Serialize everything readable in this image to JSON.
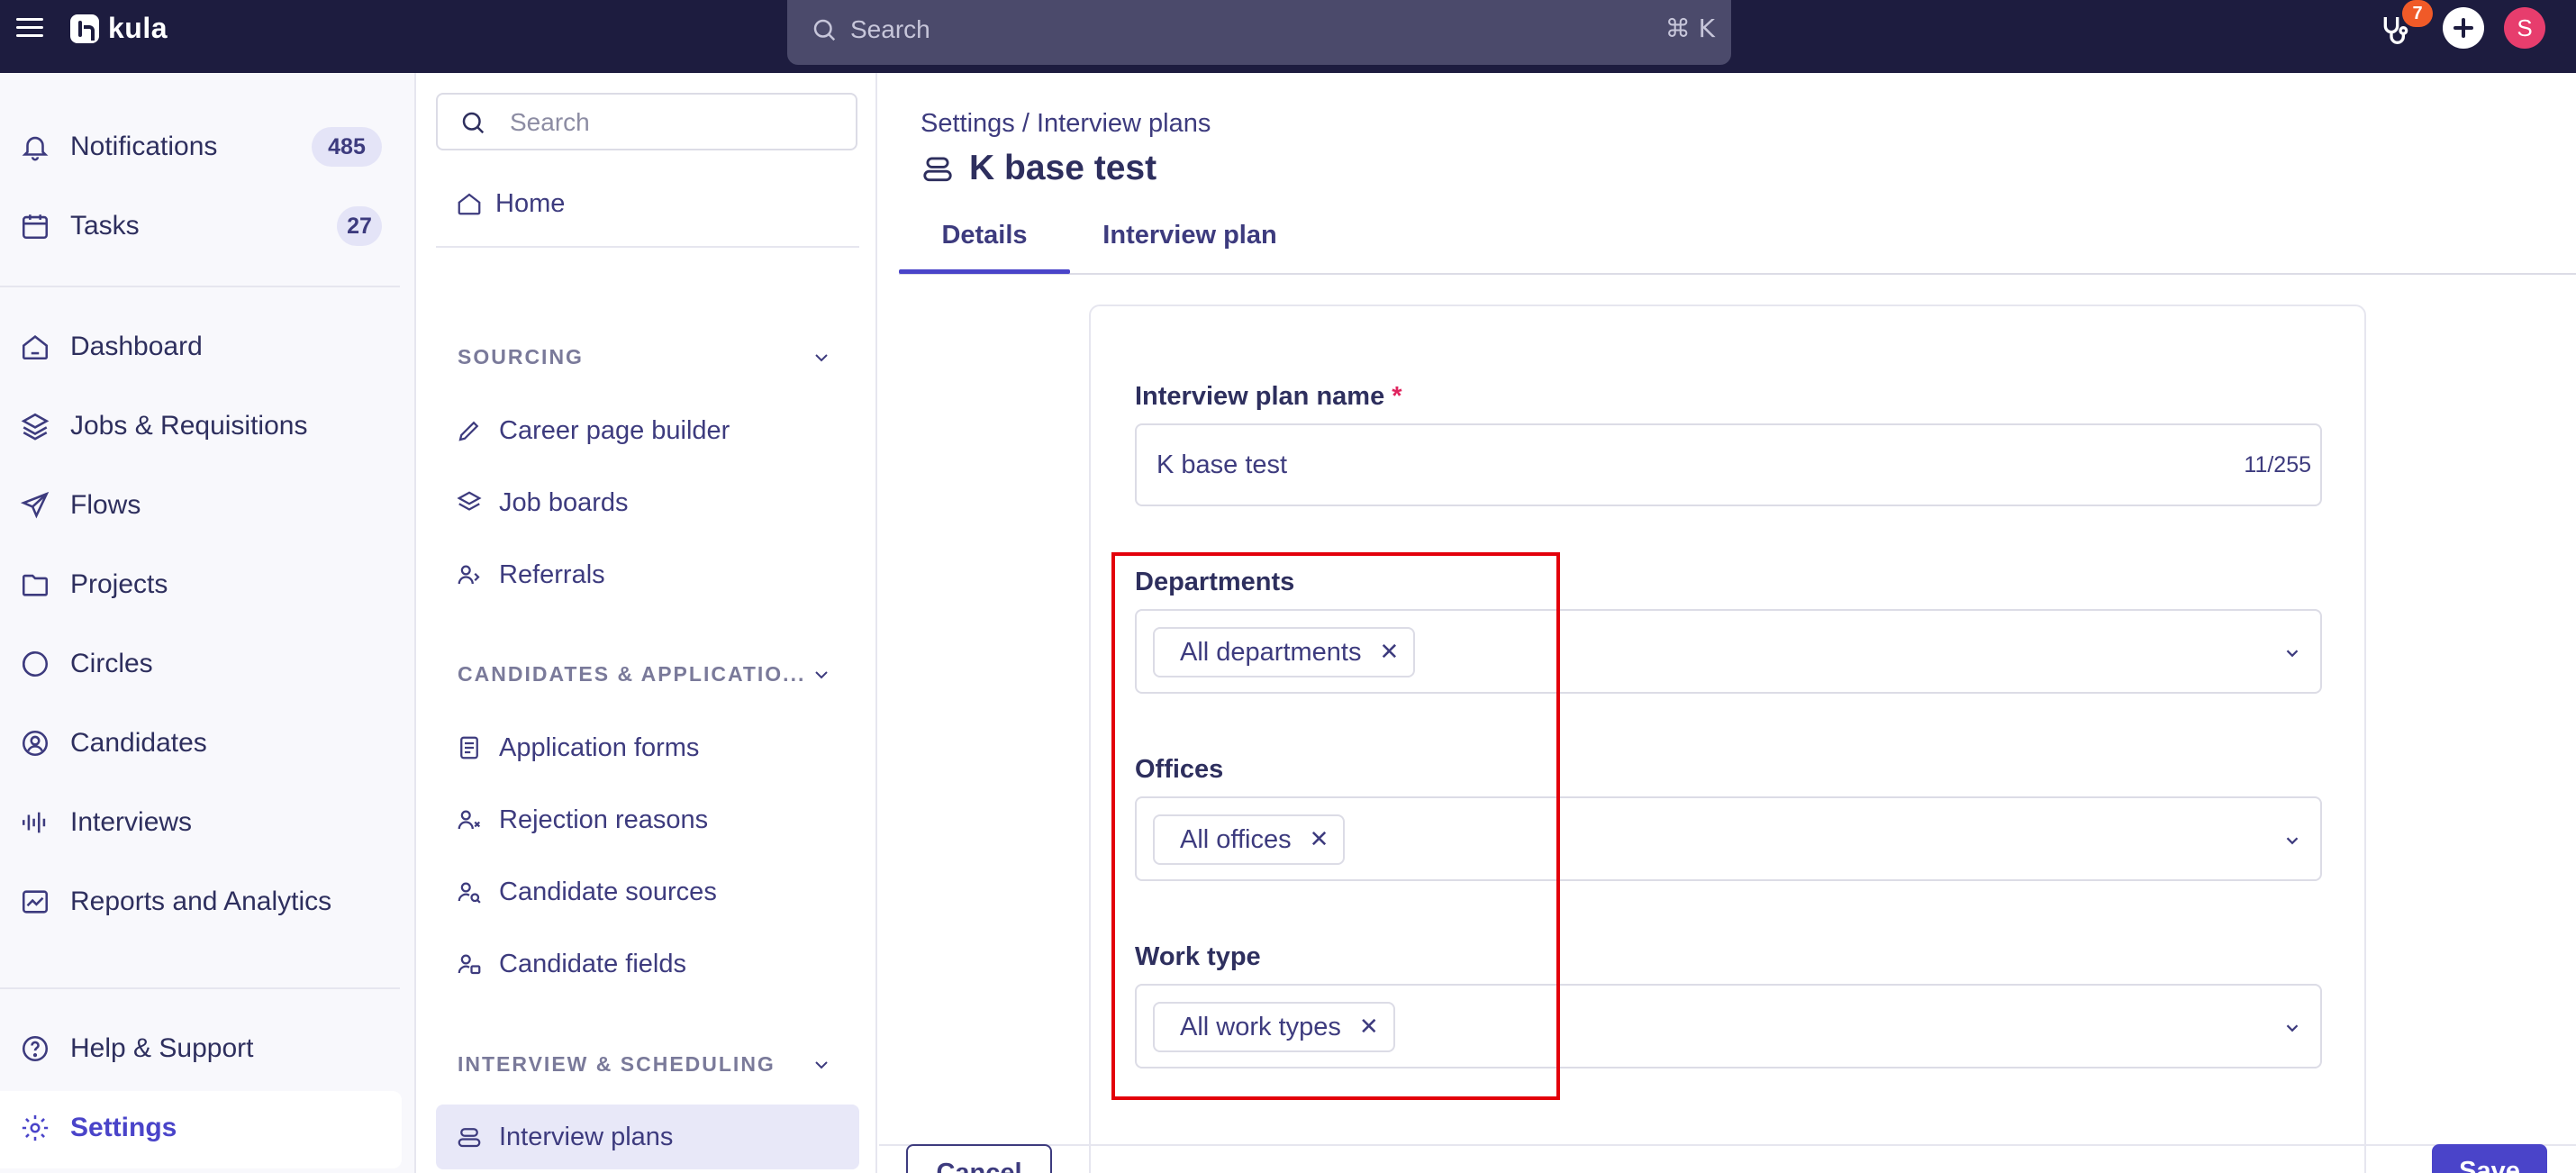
{
  "topbar": {
    "app_name": "kula",
    "search_placeholder": "Search",
    "search_shortcut": "⌘ K",
    "notification_count": "7",
    "avatar_initial": "S"
  },
  "leftnav": {
    "items": [
      {
        "label": "Notifications",
        "count": "485",
        "icon": "bell-icon"
      },
      {
        "label": "Tasks",
        "count": "27",
        "icon": "calendar-icon"
      },
      {
        "label": "Dashboard",
        "icon": "home-icon"
      },
      {
        "label": "Jobs & Requisitions",
        "icon": "layers-icon"
      },
      {
        "label": "Flows",
        "icon": "send-icon"
      },
      {
        "label": "Projects",
        "icon": "folder-icon"
      },
      {
        "label": "Circles",
        "icon": "circle-icon"
      },
      {
        "label": "Candidates",
        "icon": "user-circle-icon"
      },
      {
        "label": "Interviews",
        "icon": "audio-wave-icon"
      },
      {
        "label": "Reports and Analytics",
        "icon": "chart-icon"
      },
      {
        "label": "Help & Support",
        "icon": "help-icon"
      },
      {
        "label": "Settings",
        "icon": "gear-icon"
      }
    ]
  },
  "subnav": {
    "search_placeholder": "Search",
    "home_label": "Home",
    "sections": [
      {
        "title": "SOURCING",
        "items": [
          "Career page builder",
          "Job boards",
          "Referrals"
        ]
      },
      {
        "title": "CANDIDATES & APPLICATIO...",
        "items": [
          "Application forms",
          "Rejection reasons",
          "Candidate sources",
          "Candidate fields"
        ]
      },
      {
        "title": "INTERVIEW & SCHEDULING",
        "items": [
          "Interview plans"
        ]
      }
    ]
  },
  "main": {
    "breadcrumb": "Settings / Interview plans",
    "title": "K base test",
    "tabs": [
      "Details",
      "Interview plan"
    ],
    "form": {
      "name_label": "Interview plan name",
      "required_mark": "*",
      "name_value": "K base test",
      "name_counter": "11/255",
      "departments_label": "Departments",
      "departments_chip": "All departments",
      "offices_label": "Offices",
      "offices_chip": "All offices",
      "work_type_label": "Work type",
      "work_type_chip": "All work types"
    },
    "cancel_label": "Cancel",
    "save_label": "Save"
  },
  "colors": {
    "topbar": "#1d1c3f",
    "accent": "#4a44c9",
    "highlight": "#e3000b",
    "badge": "#f05a28",
    "avatar": "#e73d6d"
  }
}
